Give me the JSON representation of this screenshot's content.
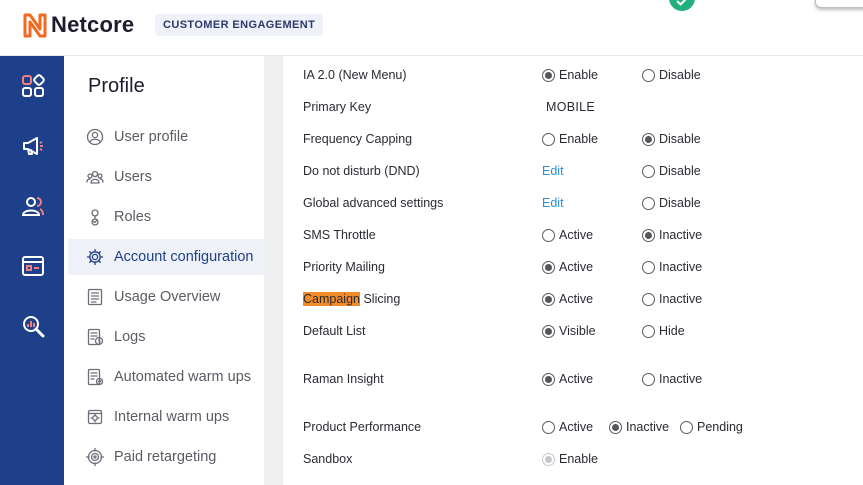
{
  "topbar": {
    "brand": "Netcore",
    "product": "CUSTOMER ENGAGEMENT",
    "status_icon": "check-circle-icon",
    "colors": {
      "brand_orange": "#f26a21",
      "sidebar_blue": "#1e3f8a",
      "success_green": "#22b07d",
      "highlight": "#f28c28",
      "link": "#2f8fd6"
    }
  },
  "iconbar": {
    "items": [
      {
        "icon": "dashboard-grid-icon"
      },
      {
        "icon": "megaphone-icon"
      },
      {
        "icon": "users-icon"
      },
      {
        "icon": "content-layout-icon"
      },
      {
        "icon": "analytics-search-icon"
      }
    ]
  },
  "sidebar": {
    "title": "Profile",
    "items": [
      {
        "label": "User profile",
        "icon": "user-circle-icon",
        "active": false
      },
      {
        "label": "Users",
        "icon": "users-group-icon",
        "active": false
      },
      {
        "label": "Roles",
        "icon": "roles-icon",
        "active": false
      },
      {
        "label": "Account configuration",
        "icon": "gear-icon",
        "active": true
      },
      {
        "label": "Usage Overview",
        "icon": "list-doc-icon",
        "active": false
      },
      {
        "label": "Logs",
        "icon": "log-doc-icon",
        "active": false
      },
      {
        "label": "Automated warm ups",
        "icon": "auto-doc-icon",
        "active": false
      },
      {
        "label": "Internal warm ups",
        "icon": "internal-gear-icon",
        "active": false
      },
      {
        "label": "Paid retargeting",
        "icon": "target-icon",
        "active": false
      }
    ]
  },
  "settings": {
    "rows": [
      {
        "label": "IA 2.0 (New Menu)",
        "options": [
          {
            "type": "radio",
            "label": "Enable",
            "checked": true
          },
          {
            "type": "radio",
            "label": "Disable",
            "checked": false
          }
        ]
      },
      {
        "label": "Primary Key",
        "value": "MOBILE"
      },
      {
        "label": "Frequency Capping",
        "options": [
          {
            "type": "radio",
            "label": "Enable",
            "checked": false
          },
          {
            "type": "radio",
            "label": "Disable",
            "checked": true
          }
        ]
      },
      {
        "label": "Do not disturb (DND)",
        "options": [
          {
            "type": "link",
            "label": "Edit"
          },
          {
            "type": "radio",
            "label": "Disable",
            "checked": false
          }
        ]
      },
      {
        "label": "Global advanced settings",
        "options": [
          {
            "type": "link",
            "label": "Edit"
          },
          {
            "type": "radio",
            "label": "Disable",
            "checked": false
          }
        ]
      },
      {
        "label": "SMS Throttle",
        "options": [
          {
            "type": "radio",
            "label": "Active",
            "checked": false
          },
          {
            "type": "radio",
            "label": "Inactive",
            "checked": true
          }
        ]
      },
      {
        "label": "Priority Mailing",
        "options": [
          {
            "type": "radio",
            "label": "Active",
            "checked": true
          },
          {
            "type": "radio",
            "label": "Inactive",
            "checked": false
          }
        ]
      },
      {
        "label_highlight": "Campaign",
        "label_rest": " Slicing",
        "options": [
          {
            "type": "radio",
            "label": "Active",
            "checked": true
          },
          {
            "type": "radio",
            "label": "Inactive",
            "checked": false
          }
        ]
      },
      {
        "label": "Default List",
        "options": [
          {
            "type": "radio",
            "label": "Visible",
            "checked": true
          },
          {
            "type": "radio",
            "label": "Hide",
            "checked": false
          }
        ]
      },
      {
        "label": "Raman Insight",
        "options": [
          {
            "type": "radio",
            "label": "Active",
            "checked": true
          },
          {
            "type": "radio",
            "label": "Inactive",
            "checked": false
          }
        ]
      },
      {
        "label": "Product Performance",
        "options": [
          {
            "type": "radio",
            "label": "Active",
            "checked": false
          },
          {
            "type": "radio",
            "label": "Inactive",
            "checked": true
          },
          {
            "type": "radio",
            "label": "Pending",
            "checked": false
          }
        ]
      },
      {
        "label": "Sandbox",
        "options": [
          {
            "type": "radio",
            "label": "Enable",
            "checked": true,
            "disabled": true
          }
        ]
      }
    ]
  }
}
